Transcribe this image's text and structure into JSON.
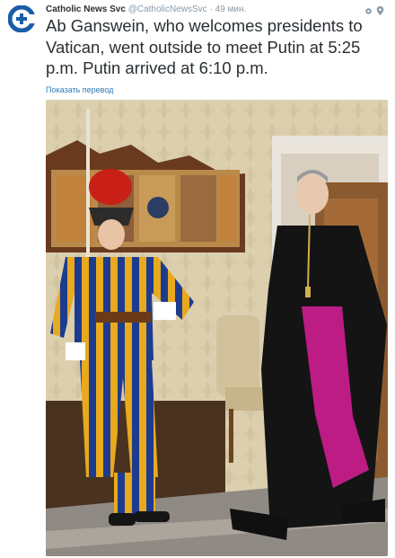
{
  "tweet": {
    "author_name": "Catholic News Svc",
    "handle": "@CatholicNewsSvc",
    "separator": "·",
    "timestamp": "49 мин.",
    "text": "Ab Ganswein, who welcomes presidents to Vatican, went outside to meet Putin at 5:25 p.m. Putin arrived at 6:10 p.m.",
    "translate_link": "Показать перевод",
    "avatar_icon": "catholic-news-logo-icon",
    "action_icons": [
      "settings-icon",
      "location-pin-icon"
    ],
    "brand_color": "#1b5ea7"
  }
}
